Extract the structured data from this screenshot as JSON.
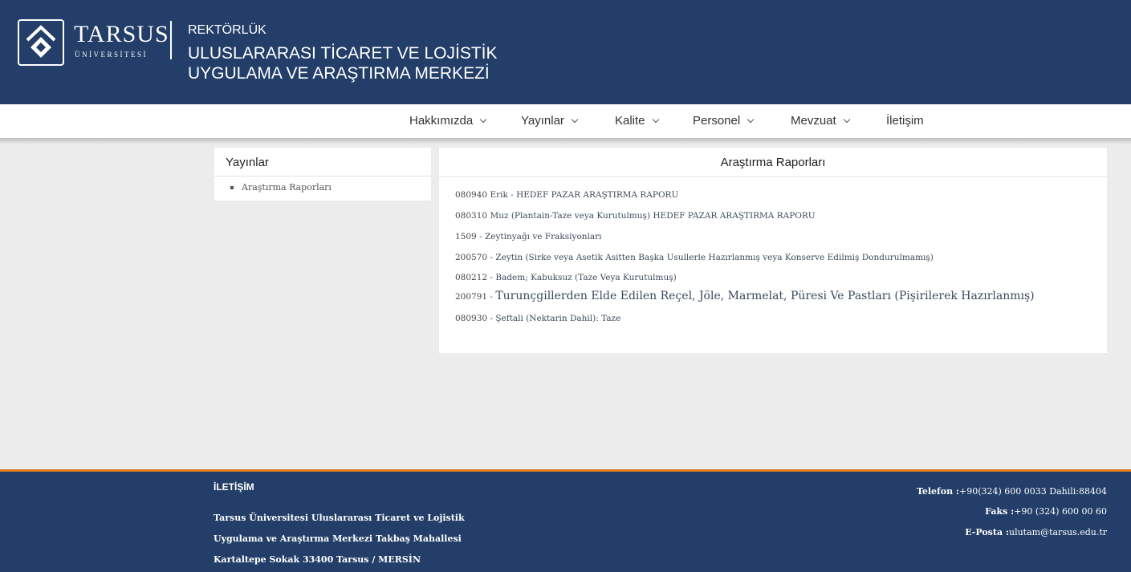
{
  "header": {
    "logo_name": "TARSUS",
    "logo_sub": "ÜNİVERSİTESİ",
    "rektorluk": "REKTÖRLÜK",
    "center_line1": "ULUSLARARASI TİCARET VE LOJİSTİK",
    "center_line2": "UYGULAMA VE ARAŞTIRMA MERKEZİ",
    "bg_color": "#233e68"
  },
  "nav": {
    "items": [
      {
        "label": "Hakkımızda",
        "dropdown": true
      },
      {
        "label": "Yayınlar",
        "dropdown": true
      },
      {
        "label": "Kalite",
        "dropdown": true
      },
      {
        "label": "Personel",
        "dropdown": true
      },
      {
        "label": "Mevzuat",
        "dropdown": true
      },
      {
        "label": "İletişim",
        "dropdown": false
      }
    ]
  },
  "sidebar": {
    "title": "Yayınlar",
    "items": [
      {
        "label": "Araştırma Raporları"
      }
    ]
  },
  "main": {
    "title": "Araştırma Raporları",
    "reports": [
      {
        "code": "080940",
        "sep": " ",
        "title": "Erik - HEDEF PAZAR ARAŞTIRMA RAPORU"
      },
      {
        "code": "080310",
        "sep": " ",
        "title": "Muz (Plantain-Taze veya Kurutulmuş) HEDEF PAZAR ARAŞTIRMA RAPORU"
      },
      {
        "code": "1509",
        "sep": " - ",
        "title": "Zeytinyağı ve Fraksiyonları"
      },
      {
        "code": "200570",
        "sep": " - ",
        "title": "Zeytin (Sirke veya Asetik Asitten Başka Usullerle Hazırlanmış veya Konserve Edilmiş Dondurulmamış)"
      },
      {
        "code": "080212",
        "sep": " - ",
        "title": "Badem; Kabuksuz (Taze Veya Kurutulmuş)"
      },
      {
        "code": "200791",
        "sep": " - ",
        "title": "Turunçgillerden Elde Edilen Reçel, Jöle, Marmelat, Püresi Ve Pastları (Pişirilerek Hazırlanmış)"
      },
      {
        "code": "080930",
        "sep": " - ",
        "title": "Şeftali (Nektarin Dahil): Taze"
      }
    ]
  },
  "footer": {
    "heading": "İLETİŞİM",
    "address_lines": [
      "Tarsus Üniversitesi Uluslararası Ticaret ve Lojistik",
      "Uygulama ve Araştırma Merkezi Takbaş Mahallesi",
      "Kartaltepe Sokak 33400 Tarsus / MERSİN"
    ],
    "phone_label": "Telefon :",
    "phone": "+90(324) 600 0033 Dahili:88404",
    "fax_label": "Faks :",
    "fax": "+90 (324) 600 00 60",
    "email_label": "E-Posta :",
    "email": "ulutam@tarsus.edu.tr",
    "accent_color": "#e07b1c"
  }
}
